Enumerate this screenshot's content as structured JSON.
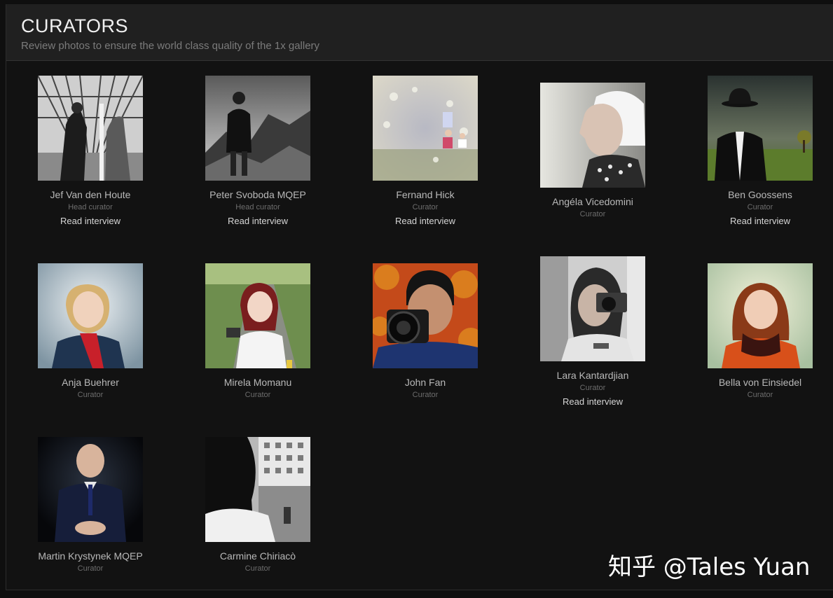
{
  "header": {
    "title": "CURATORS",
    "subtitle": "Review photos to ensure the world class quality of the 1x gallery"
  },
  "curators": [
    {
      "name": "Jef Van den Houte",
      "role": "Head curator",
      "link": "Read interview"
    },
    {
      "name": "Peter Svoboda MQEP",
      "role": "Head curator",
      "link": "Read interview"
    },
    {
      "name": "Fernand Hick",
      "role": "Curator",
      "link": "Read interview"
    },
    {
      "name": "Angéla Vicedomini",
      "role": "Curator"
    },
    {
      "name": "Ben Goossens",
      "role": "Curator",
      "link": "Read interview"
    },
    {
      "name": "Anja Buehrer",
      "role": "Curator"
    },
    {
      "name": "Mirela Momanu",
      "role": "Curator"
    },
    {
      "name": "John Fan",
      "role": "Curator"
    },
    {
      "name": "Lara Kantardjian",
      "role": "Curator",
      "link": "Read interview"
    },
    {
      "name": "Bella von Einsiedel",
      "role": "Curator"
    },
    {
      "name": "Martin Krystynek MQEP",
      "role": "Curator"
    },
    {
      "name": "Carmine Chiriacò",
      "role": "Curator"
    }
  ],
  "watermark": "知乎 @Tales Yuan"
}
